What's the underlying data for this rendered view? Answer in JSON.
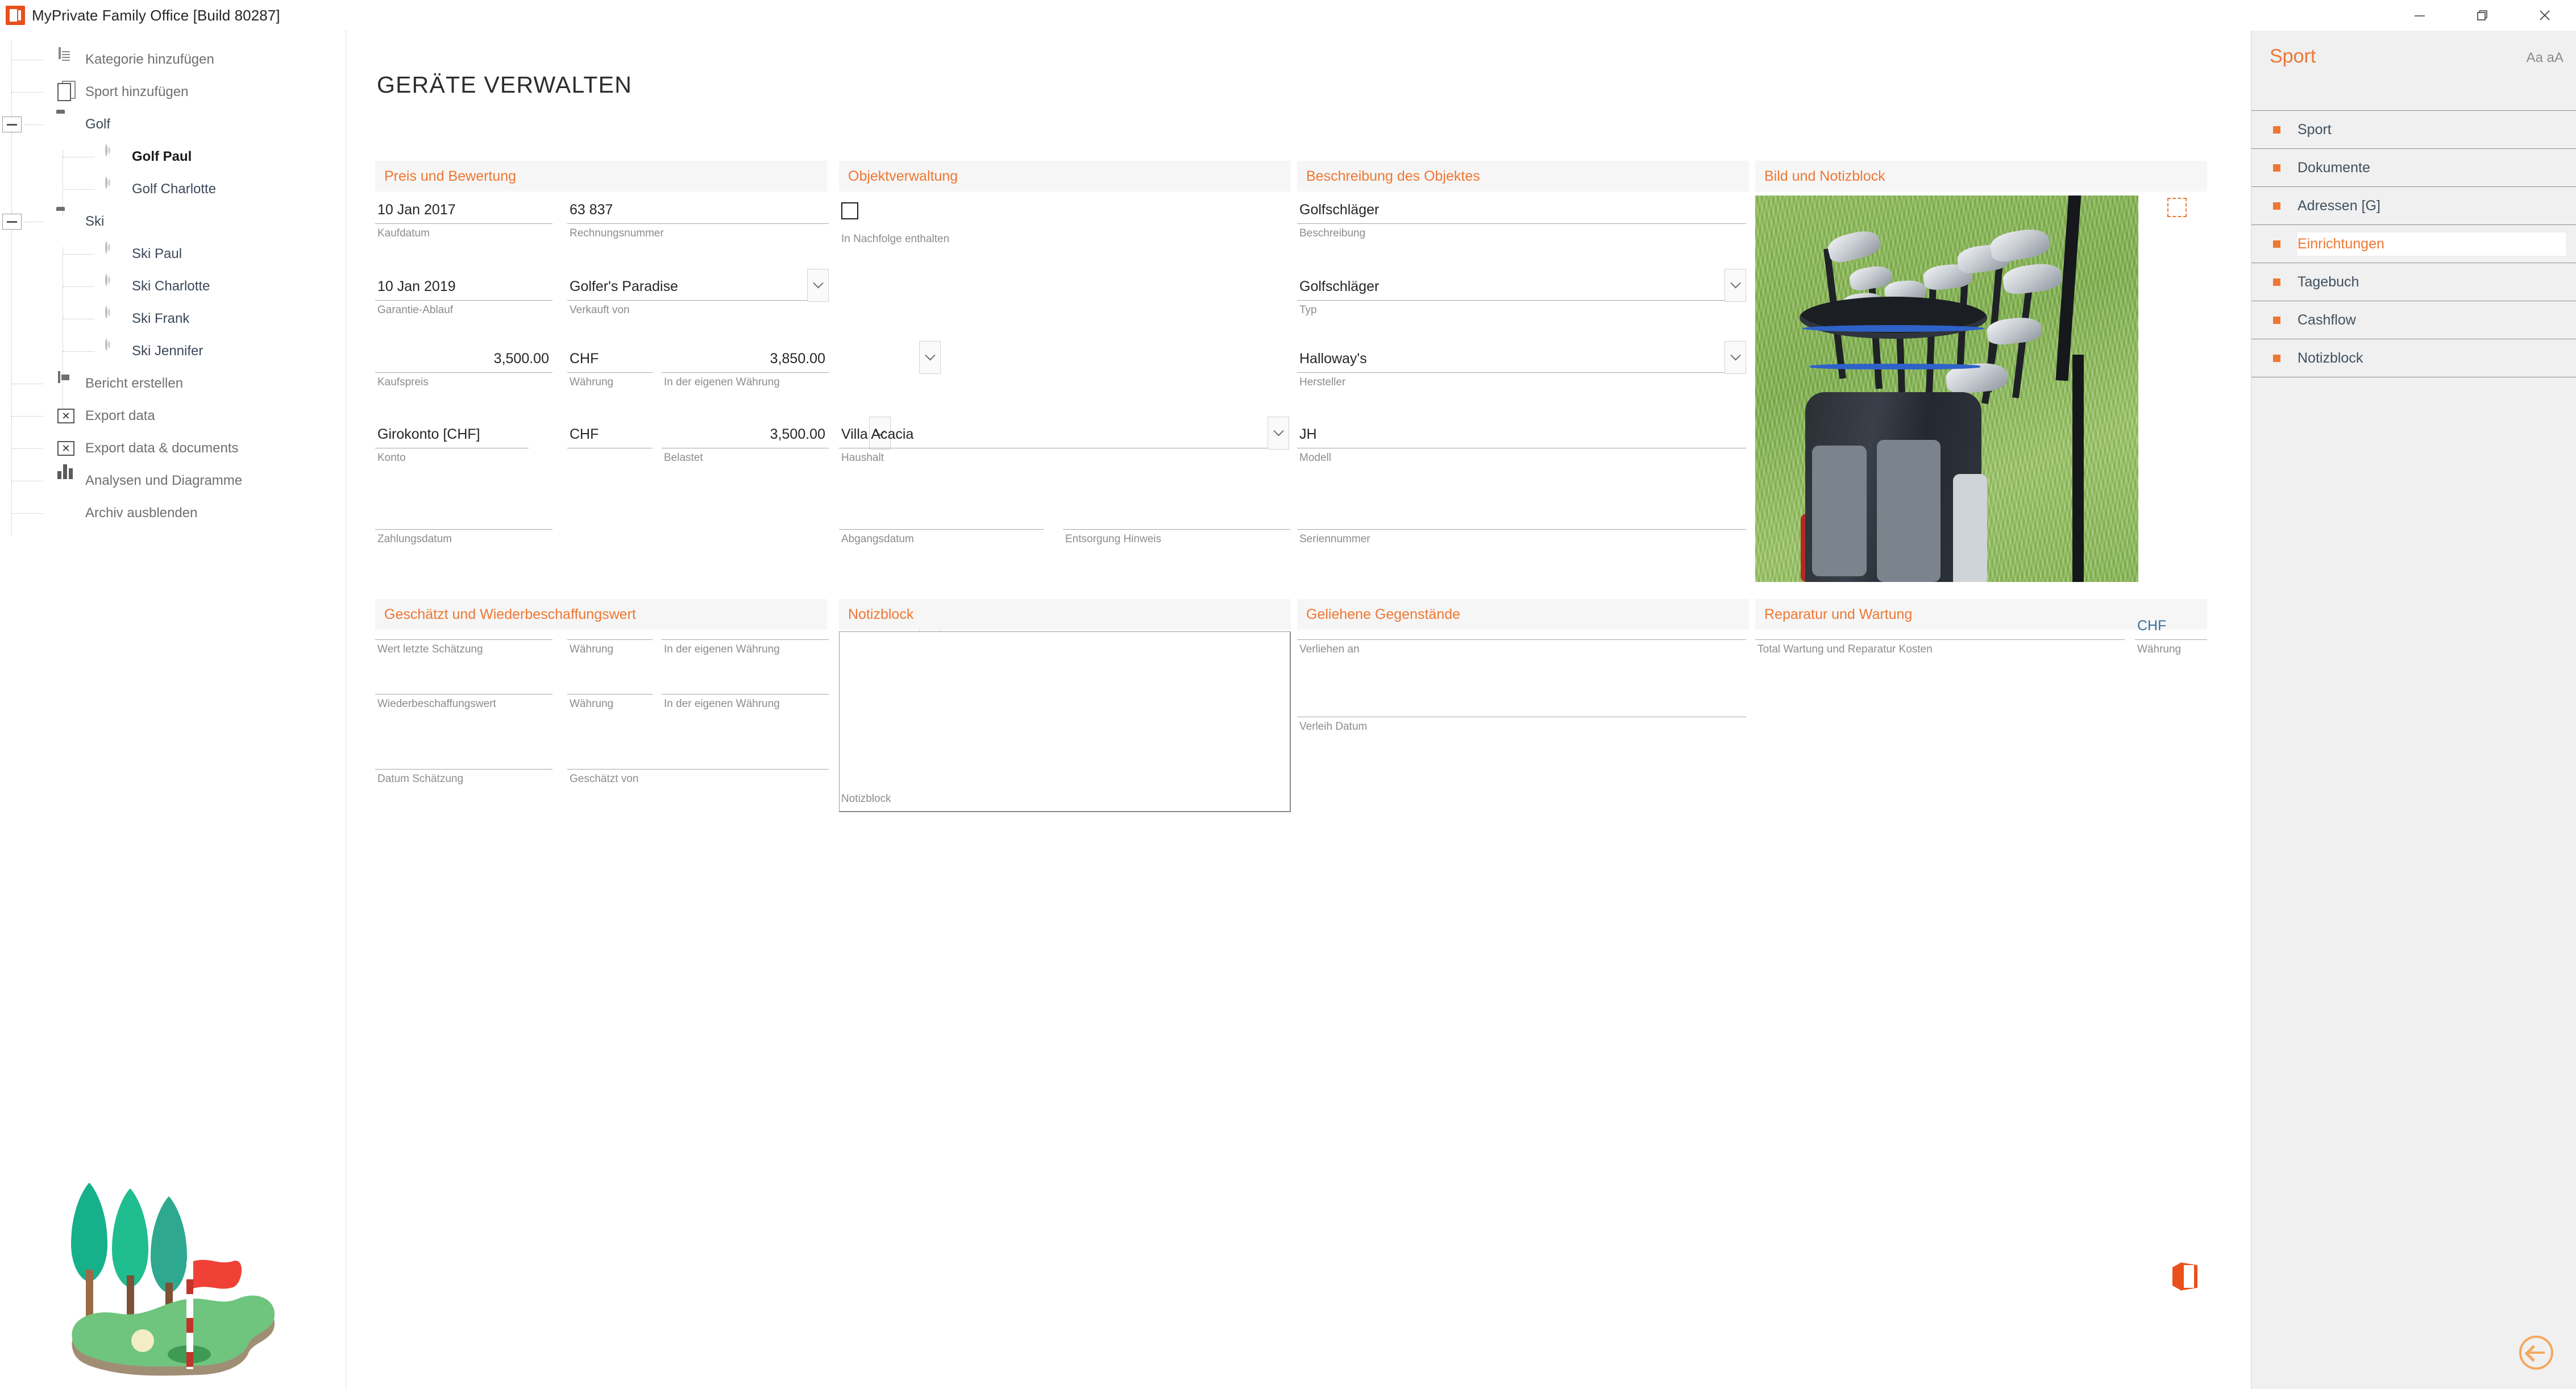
{
  "window": {
    "title": "MyPrivate Family Office [Build 80287]",
    "icon": "app-icon",
    "minimize": "minimize-icon",
    "restore": "restore-icon",
    "close": "close-icon"
  },
  "sidebar": {
    "items": [
      {
        "label": "Kategorie hinzufügen",
        "icon": "document-icon",
        "level": 1,
        "type": "action"
      },
      {
        "label": "Sport hinzufügen",
        "icon": "documents-icon",
        "level": 1,
        "type": "action"
      },
      {
        "label": "Golf",
        "icon": "folder-icon",
        "level": 1,
        "type": "folder",
        "expanded": true
      },
      {
        "label": "Golf Paul",
        "icon": "ring-icon",
        "level": 2,
        "type": "leaf",
        "selected": true
      },
      {
        "label": "Golf Charlotte",
        "icon": "ring-icon",
        "level": 2,
        "type": "leaf"
      },
      {
        "label": "Ski",
        "icon": "folder-icon",
        "level": 1,
        "type": "folder",
        "expanded": true
      },
      {
        "label": "Ski Paul",
        "icon": "ring-icon",
        "level": 2,
        "type": "leaf"
      },
      {
        "label": "Ski Charlotte",
        "icon": "ring-icon",
        "level": 2,
        "type": "leaf"
      },
      {
        "label": "Ski Frank",
        "icon": "ring-icon",
        "level": 2,
        "type": "leaf"
      },
      {
        "label": "Ski Jennifer",
        "icon": "ring-icon",
        "level": 2,
        "type": "leaf"
      },
      {
        "label": "Bericht erstellen",
        "icon": "report-icon",
        "level": 1,
        "type": "action"
      },
      {
        "label": "Export data",
        "icon": "export-icon",
        "level": 1,
        "type": "action"
      },
      {
        "label": "Export data & documents",
        "icon": "export-icon",
        "level": 1,
        "type": "action"
      },
      {
        "label": "Analysen und Diagramme",
        "icon": "chart-icon",
        "level": 1,
        "type": "action"
      },
      {
        "label": "Archiv ausblenden",
        "icon": "book-icon",
        "level": 1,
        "type": "action"
      }
    ]
  },
  "main": {
    "page_title": "GERÄTE VERWALTEN",
    "panels": {
      "preis": {
        "title": "Preis und Bewertung",
        "kaufdatum": {
          "label": "Kaufdatum",
          "value": "10 Jan 2017"
        },
        "rechnungsnummer": {
          "label": "Rechnungsnummer",
          "value": "63 837"
        },
        "garantie": {
          "label": "Garantie-Ablauf",
          "value": "10 Jan 2019"
        },
        "verkauft_von": {
          "label": "Verkauft von",
          "value": "Golfer's Paradise"
        },
        "kaufspreis": {
          "label": "Kaufspreis",
          "value": "3,500.00"
        },
        "waehrung": {
          "label": "Währung",
          "value": "CHF"
        },
        "eigene_waehrung": {
          "label": "In der eigenen Währung",
          "value": "3,850.00"
        },
        "konto": {
          "label": "Konto",
          "value": "Girokonto [CHF]"
        },
        "konto_waehrung": {
          "label": "",
          "value": "CHF"
        },
        "belastet": {
          "label": "Belastet",
          "value": "3,500.00"
        },
        "zahlungsdatum": {
          "label": "Zahlungsdatum",
          "value": ""
        }
      },
      "objekt": {
        "title": "Objektverwaltung",
        "nachfolge": {
          "label": "In Nachfolge enthalten",
          "checked": false
        },
        "haushalt": {
          "label": "Haushalt",
          "value": "Villa Acacia"
        },
        "abgangsdatum": {
          "label": "Abgangsdatum",
          "value": ""
        },
        "entsorgung": {
          "label": "Entsorgung Hinweis",
          "value": ""
        }
      },
      "beschreibung": {
        "title": "Beschreibung des Objektes",
        "beschreibung": {
          "label": "Beschreibung",
          "value": "Golfschläger"
        },
        "typ": {
          "label": "Typ",
          "value": "Golfschläger"
        },
        "hersteller": {
          "label": "Hersteller",
          "value": "Halloway's"
        },
        "modell": {
          "label": "Modell",
          "value": "JH"
        },
        "seriennummer": {
          "label": "Seriennummer",
          "value": ""
        }
      },
      "bild": {
        "title": "Bild und Notizblock",
        "image_alt": "golf-clubs-in-bag-photo",
        "picker": "image-picker-placeholder"
      },
      "geschaetzt": {
        "title": "Geschätzt und Wiederbeschaffungswert",
        "wert_letzte": {
          "label": "Wert letzte Schätzung",
          "value": ""
        },
        "waehrung1": {
          "label": "Währung",
          "value": ""
        },
        "eigene1": {
          "label": "In der eigenen Währung",
          "value": ""
        },
        "wiederbeschaffung": {
          "label": "Wiederbeschaffungswert",
          "value": ""
        },
        "waehrung2": {
          "label": "Währung",
          "value": ""
        },
        "eigene2": {
          "label": "In der eigenen Währung",
          "value": ""
        },
        "datum_schaetzung": {
          "label": "Datum Schätzung",
          "value": ""
        },
        "geschaetzt_von": {
          "label": "Geschätzt von",
          "value": ""
        }
      },
      "notizblock": {
        "title": "Notizblock",
        "label": "Notizblock",
        "value": ""
      },
      "geliehene": {
        "title": "Geliehene Gegenstände",
        "verliehen_an": {
          "label": "Verliehen an",
          "value": ""
        },
        "verleih_datum": {
          "label": "Verleih Datum",
          "value": ""
        }
      },
      "reparatur": {
        "title": "Reparatur und Wartung",
        "total": {
          "label": "Total Wartung und Reparatur Kosten",
          "value": ""
        },
        "waehrung": {
          "label": "Währung",
          "value": "CHF"
        }
      }
    },
    "illustration": "golf-course-illustration",
    "office_logo": "office-logo"
  },
  "right_panel": {
    "title": "Sport",
    "font_toggle": "Aa aA",
    "items": [
      {
        "label": "Sport"
      },
      {
        "label": "Dokumente"
      },
      {
        "label": "Adressen [G]"
      },
      {
        "label": "Einrichtungen",
        "active": true
      },
      {
        "label": "Tagebuch"
      },
      {
        "label": "Cashflow"
      },
      {
        "label": "Notizblock"
      }
    ],
    "back_button": "back-arrow-button"
  },
  "colors": {
    "accent": "#ee7733",
    "app_icon": "#e8501c",
    "panel_header_bg": "#f6f6f6",
    "right_panel_bg": "#f0f0f0"
  }
}
